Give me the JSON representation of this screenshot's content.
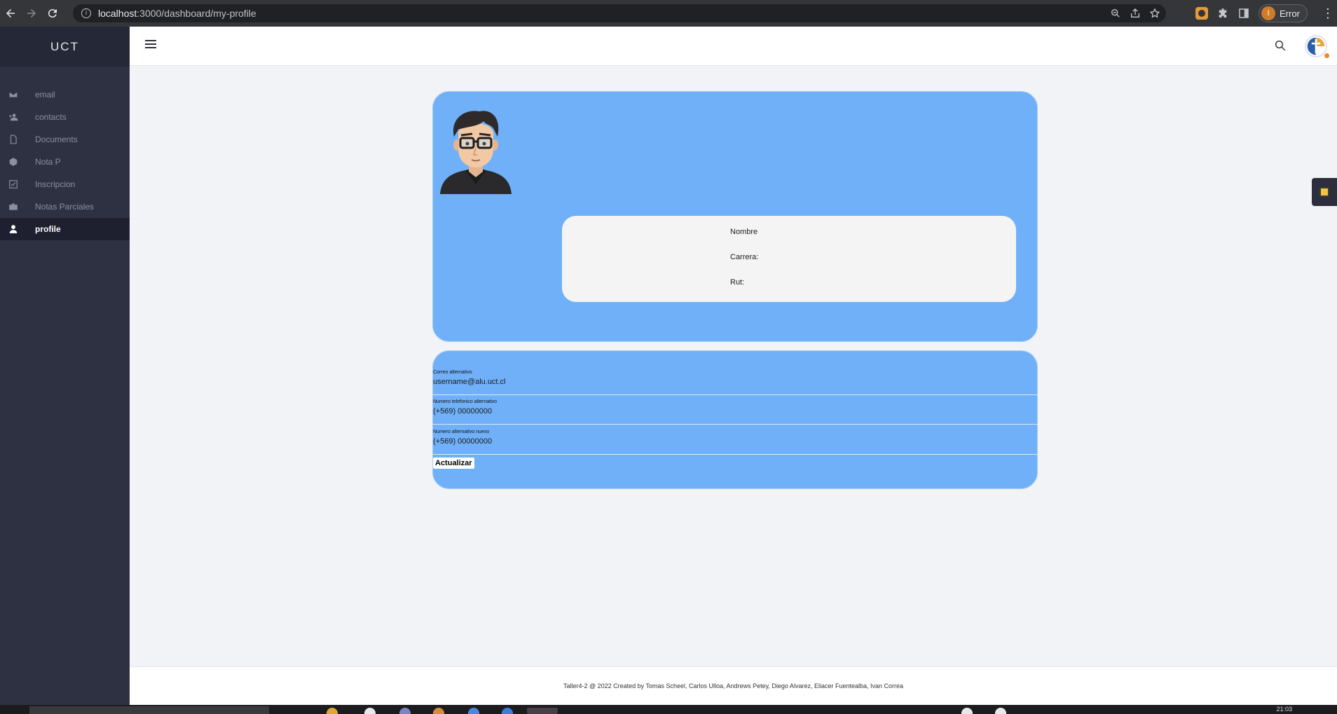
{
  "browser": {
    "url_host": "localhost",
    "url_path": ":3000/dashboard/my-profile",
    "profile_initial": "I",
    "profile_status": "Error"
  },
  "sidebar": {
    "brand": "UCT",
    "items": [
      {
        "label": "email",
        "icon": "mail-icon"
      },
      {
        "label": "contacts",
        "icon": "user-plus-icon"
      },
      {
        "label": "Documents",
        "icon": "document-icon"
      },
      {
        "label": "Nota P",
        "icon": "cube-icon"
      },
      {
        "label": "Inscripcion",
        "icon": "checkbox-icon"
      },
      {
        "label": "Notas Parciales",
        "icon": "briefcase-icon"
      },
      {
        "label": "profile",
        "icon": "user-icon",
        "active": true
      }
    ]
  },
  "profile": {
    "nombre_label": "Nombre",
    "carrera_label": "Carrera:",
    "rut_label": "Rut:"
  },
  "form": {
    "fields": [
      {
        "label": "Correo alternativo",
        "value": "username@alu.uct.cl"
      },
      {
        "label": "Numero telefonico alternativo",
        "value": "(+569) 00000000"
      },
      {
        "label": "Numero alternativo nuevo",
        "value": "(+569) 00000000"
      }
    ],
    "submit_label": "Actualizar"
  },
  "footer": {
    "text": "Taller4-2 @ 2022 Created by Tomas Scheel, Carlos Ulloa, Andrews Petey, Diego Alvarez, Eliacer Fuentealba, Ivan Correa"
  },
  "taskbar": {
    "clock": "21:03"
  },
  "colors": {
    "sidebar_bg": "#2e3142",
    "card_bg": "#70b0f8",
    "info_bg": "#f4f4f4",
    "page_bg": "#f2f3f6"
  }
}
